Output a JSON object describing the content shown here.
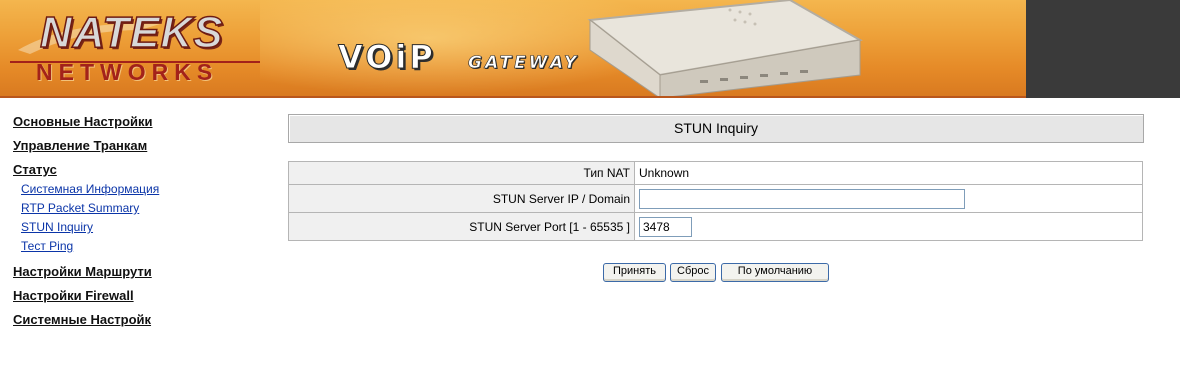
{
  "header": {
    "logo_top": "NATEKS",
    "logo_bottom": "NETWORKS",
    "product_title": "VOiP",
    "product_subtitle": "GATEWAY"
  },
  "nav": {
    "items": [
      {
        "label": "Основные Настройки",
        "level": "main"
      },
      {
        "label": "Управление Транкам",
        "level": "main"
      },
      {
        "label": "Статус",
        "level": "main"
      },
      {
        "label": "Системная Информация",
        "level": "sub"
      },
      {
        "label": "RTP Packet Summary",
        "level": "sub"
      },
      {
        "label": "STUN Inquiry",
        "level": "sub"
      },
      {
        "label": "Тест Ping",
        "level": "sub"
      },
      {
        "label": "Настройки Маршрути",
        "level": "main"
      },
      {
        "label": "Настройки Firewall",
        "level": "main"
      },
      {
        "label": "Системные Настройк",
        "level": "main"
      }
    ]
  },
  "page": {
    "title": "STUN Inquiry"
  },
  "form": {
    "nat_type_label": "Тип NAT",
    "nat_type_value": "Unknown",
    "server_label": "STUN Server IP / Domain",
    "server_value": "",
    "port_label": "STUN Server Port [1 - 65535 ]",
    "port_value": "3478"
  },
  "buttons": {
    "apply": "Принять",
    "reset": "Сброс",
    "default": "По умолчанию"
  }
}
